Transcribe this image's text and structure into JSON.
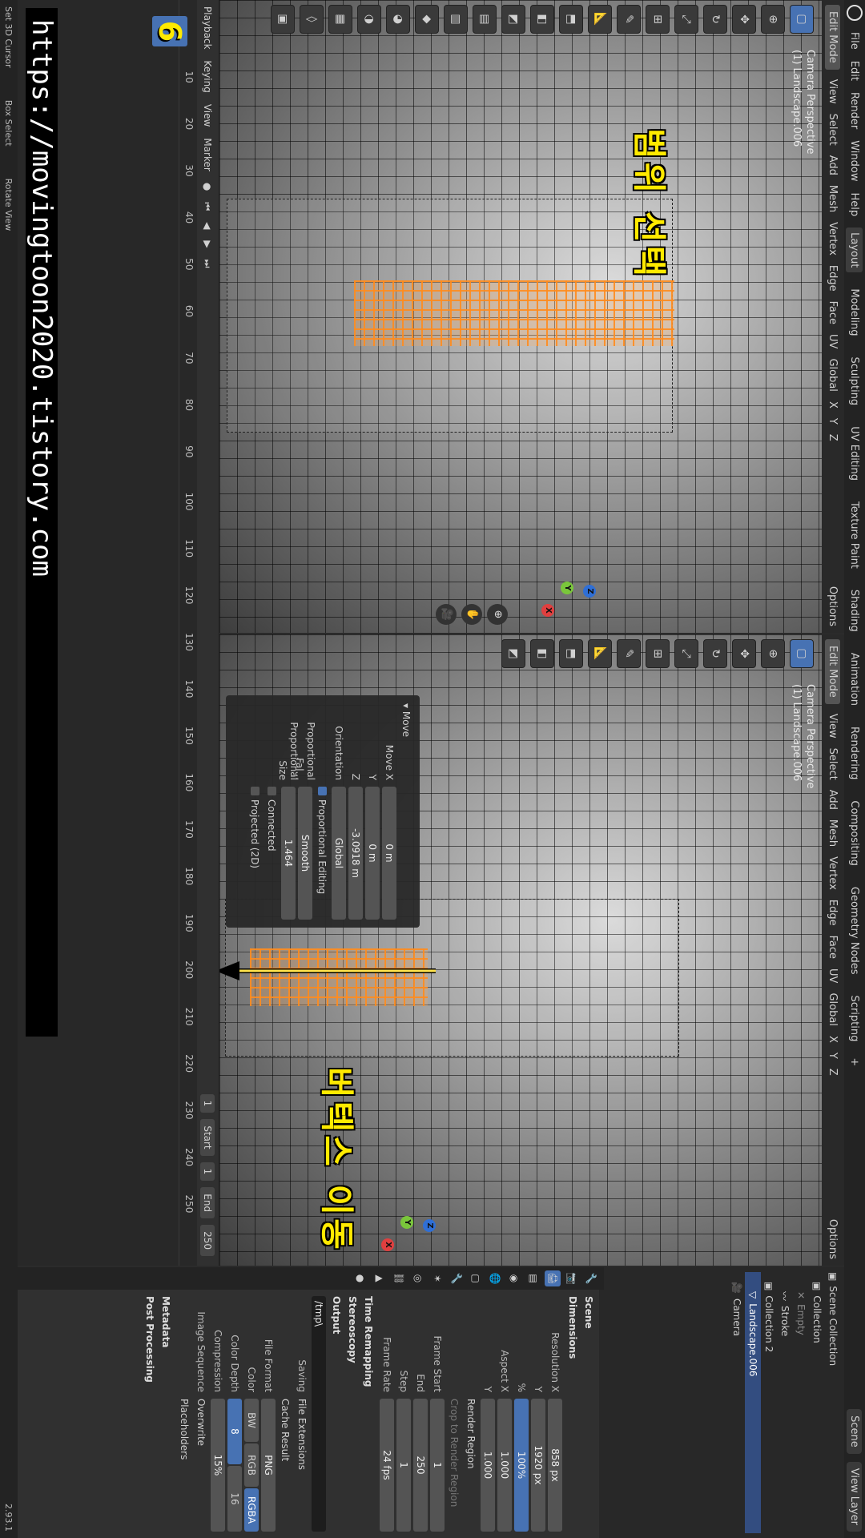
{
  "menu": {
    "items": [
      "File",
      "Edit",
      "Render",
      "Window",
      "Help"
    ],
    "workspaces": [
      "Layout",
      "Modeling",
      "Sculpting",
      "UV Editing",
      "Texture Paint",
      "Shading",
      "Animation",
      "Rendering",
      "Compositing",
      "Geometry Nodes",
      "Scripting"
    ],
    "add_tab": "+",
    "scene": "Scene",
    "view_layer": "View Layer"
  },
  "viewport_header": {
    "mode": "Edit Mode",
    "menus": [
      "View",
      "Select",
      "Add",
      "Mesh",
      "Vertex",
      "Edge",
      "Face",
      "UV"
    ],
    "orientation": "Global",
    "options": "Options",
    "axes": [
      "X",
      "Y",
      "Z"
    ]
  },
  "viewport_left": {
    "camera_label": "Camera Perspective",
    "object_label": "(1) Landscape.006",
    "annotation": "범위 선택"
  },
  "viewport_right": {
    "camera_label": "Camera Perspective",
    "object_label": "(1) Landscape.006",
    "annotation": "버텍스 이동"
  },
  "operator_panel": {
    "title": "Move",
    "move_x_label": "Move X",
    "move_x": "0 m",
    "y_label": "Y",
    "y": "0 m",
    "z_label": "Z",
    "z": "-3.0918 m",
    "orientation_label": "Orientation",
    "orientation": "Global",
    "proportional_editing": "Proportional Editing",
    "falloff_label": "Proportional Fal...",
    "falloff": "Smooth",
    "size_label": "Proportional Size",
    "size": "1.464",
    "connected": "Connected",
    "projected": "Projected (2D)"
  },
  "outliner": {
    "root": "Scene Collection",
    "rows": [
      "Collection",
      "Empty",
      "Stroke",
      "Collection 2",
      "Landscape.006",
      "Camera"
    ]
  },
  "properties": {
    "scene_label": "Scene",
    "dimensions": "Dimensions",
    "res_x_label": "Resolution X",
    "res_x": "858 px",
    "res_y_label": "Y",
    "res_y": "1920 px",
    "pct_label": "%",
    "pct": "100%",
    "aspect_x_label": "Aspect X",
    "aspect_x": "1.000",
    "aspect_y_label": "Y",
    "aspect_y": "1.000",
    "render_region": "Render Region",
    "crop": "Crop to Render Region",
    "frame_start_label": "Frame Start",
    "frame_start": "1",
    "end_label": "End",
    "end": "250",
    "step_label": "Step",
    "step": "1",
    "frame_rate_label": "Frame Rate",
    "frame_rate": "24 fps",
    "time_remapping": "Time Remapping",
    "stereoscopy": "Stereoscopy",
    "output": "Output",
    "output_path": "/tmp\\",
    "saving_label": "Saving",
    "file_extensions": "File Extensions",
    "cache_result": "Cache Result",
    "file_format_label": "File Format",
    "file_format": "PNG",
    "color_label": "Color",
    "color_opts": [
      "BW",
      "RGB",
      "RGBA"
    ],
    "color_depth_label": "Color Depth",
    "depth_opts": [
      "8",
      "16"
    ],
    "compression_label": "Compression",
    "compression": "15%",
    "image_sequence_label": "Image Sequence",
    "overwrite": "Overwrite",
    "placeholders": "Placeholders",
    "metadata": "Metadata",
    "post_processing": "Post Processing"
  },
  "timeline": {
    "menus": [
      "Playback",
      "Keying",
      "View",
      "Marker"
    ],
    "current_frame": "1",
    "start_label": "Start",
    "start": "1",
    "end_label": "End",
    "end": "250",
    "ticks": [
      "10",
      "20",
      "30",
      "40",
      "50",
      "60",
      "70",
      "80",
      "90",
      "100",
      "110",
      "120",
      "130",
      "140",
      "150",
      "160",
      "170",
      "180",
      "190",
      "200",
      "210",
      "220",
      "230",
      "240",
      "250"
    ],
    "badge": "6",
    "url": "https://movingtoon2020.tistory.com"
  },
  "status": {
    "set_cursor": "Set 3D Cursor",
    "box_select": "Box Select",
    "rotate_view": "Rotate View",
    "version": "2.93.1"
  },
  "colors": {
    "accent": "#4772b3",
    "selection": "#ff8c1e",
    "annotation": "#ffea00"
  }
}
